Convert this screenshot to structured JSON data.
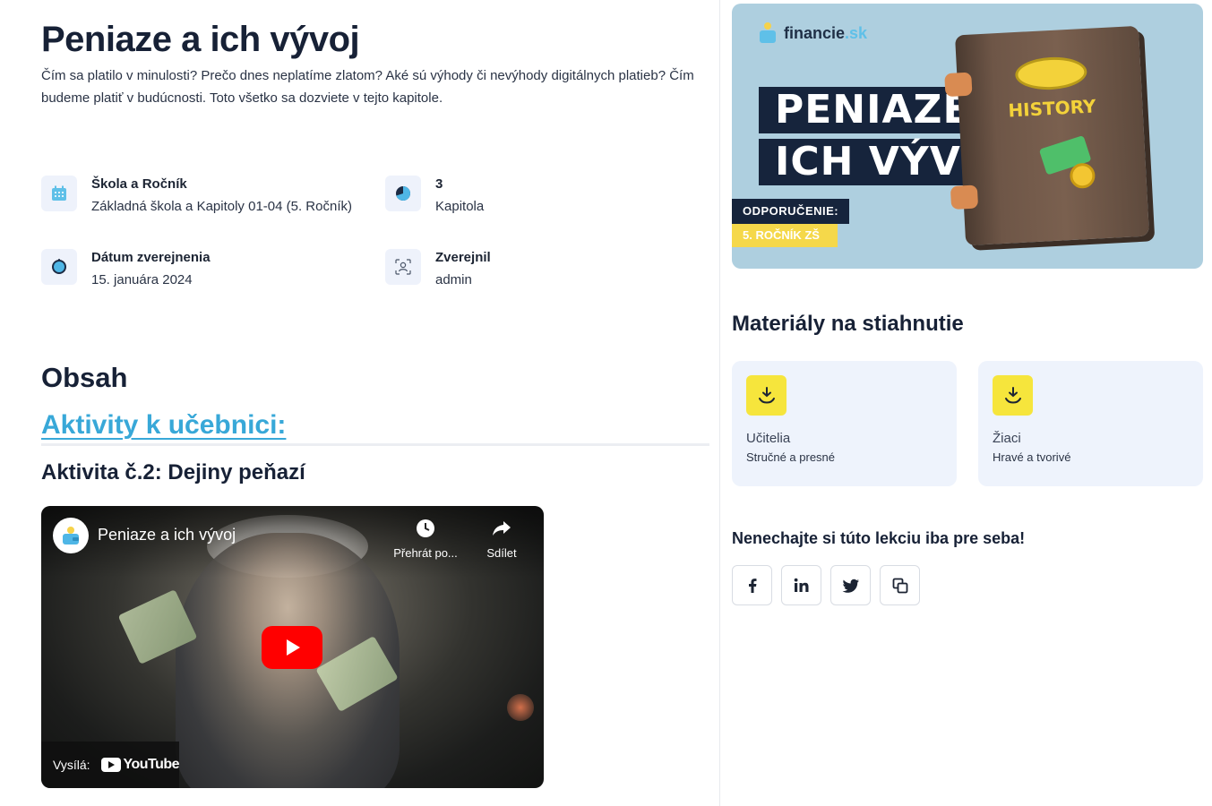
{
  "article": {
    "title": "Peniaze a ich vývoj",
    "description": "Čím sa platilo v minulosti? Prečo dnes neplatíme zlatom? Aké sú výhody či nevýhody digitálnych platieb? Čím budeme platiť v budúcnosti. Toto všetko sa dozviete v tejto kapitole."
  },
  "meta": {
    "school": {
      "label": "Škola a Ročník",
      "value": "Základná škola a Kapitoly 01-04 (5. Ročník)",
      "icon": "calendar-icon"
    },
    "chapter": {
      "label": "3",
      "value": "Kapitola",
      "icon": "pie-chart-icon"
    },
    "published": {
      "label": "Dátum zverejnenia",
      "value": "15. januára 2024",
      "icon": "clock-icon"
    },
    "author": {
      "label": "Zverejnil",
      "value": "admin",
      "icon": "user-icon"
    }
  },
  "content": {
    "heading": "Obsah",
    "link": "Aktivity k učebnici:",
    "activity": "Aktivita č.2: Dejiny peňazí"
  },
  "video": {
    "title": "Peniaze a ich vývoj",
    "watch_later": "Přehrát po...",
    "share": "Sdílet",
    "broadcast_label": "Vysílá:",
    "platform": "YouTube"
  },
  "banner": {
    "brand_name": "financie",
    "brand_tld": ".sk",
    "title_line1": "PENIAZE A",
    "title_line2": "ICH VÝVOJ",
    "recommendation": "ODPORUČENIE:",
    "grade": "5. ROČNÍK ZŠ",
    "book_label": "HISTORY"
  },
  "materials": {
    "heading": "Materiály na stiahnutie",
    "items": [
      {
        "title": "Učitelia",
        "subtitle": "Stručné a presné",
        "icon": "download-icon"
      },
      {
        "title": "Žiaci",
        "subtitle": "Hravé a tvorivé",
        "icon": "download-icon"
      }
    ]
  },
  "share": {
    "heading": "Nenechajte si túto lekciu iba pre seba!",
    "buttons": [
      "facebook-icon",
      "linkedin-icon",
      "twitter-icon",
      "copy-icon"
    ]
  },
  "colors": {
    "accent": "#38a8d8",
    "dark": "#172136",
    "card_bg": "#eef3fc",
    "download_yellow": "#f6e53c"
  }
}
